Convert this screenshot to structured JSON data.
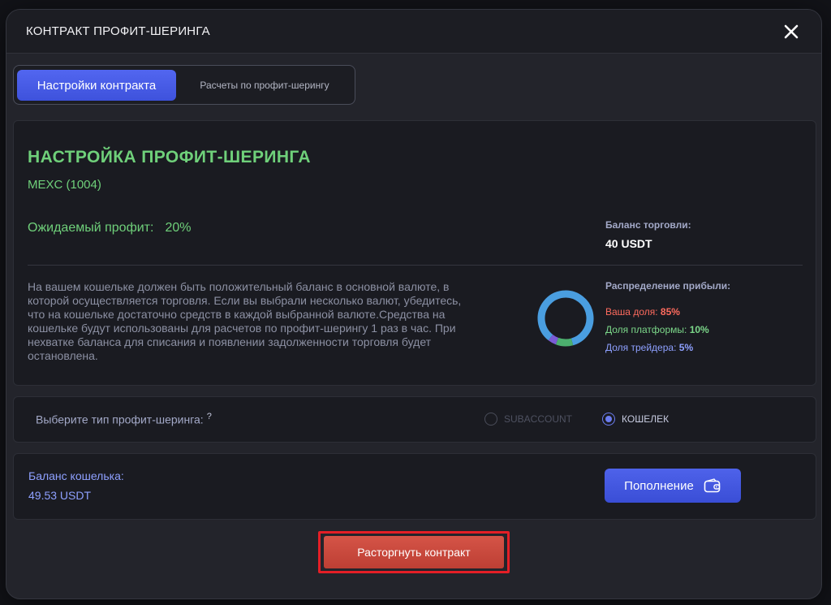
{
  "modal": {
    "title": "КОНТРАКТ ПРОФИТ-ШЕРИНГА"
  },
  "tabs": [
    {
      "label": "Настройки контракта",
      "active": true
    },
    {
      "label": "Расчеты по профит-шерингу",
      "active": false
    }
  ],
  "settings": {
    "title": "НАСТРОЙКА ПРОФИТ-ШЕРИНГА",
    "exchange": "MEXC (1004)",
    "expected_profit_label": "Ожидаемый профит:",
    "expected_profit_value": "20%",
    "trading_balance_label": "Баланс торговли:",
    "trading_balance_value": "40 USDT",
    "info_text": "На вашем кошельке должен быть положительный баланс в основной валюте, в которой осуществляется торговля. Если вы выбрали несколько валют, убедитесь, что на кошельке достаточно средств в каждой выбранной валюте.Средства на кошельке будут использованы для расчетов по профит-шерингу 1 раз в час. При нехватке баланса для списания и появлении задолженности торговля будет остановлена.",
    "distribution_label": "Распределение прибыли:",
    "shares": [
      {
        "label": "Ваша доля:",
        "value": "85%",
        "percent": 85,
        "color": "#4a9ee0"
      },
      {
        "label": "Доля платформы:",
        "value": "10%",
        "percent": 10,
        "color": "#4caf6e"
      },
      {
        "label": "Доля трейдера:",
        "value": "5%",
        "percent": 5,
        "color": "#7a5cd6"
      }
    ]
  },
  "profit_type": {
    "label": "Выберите тип профит-шеринга:",
    "help_glyph": "?",
    "options": [
      {
        "label": "SUBACCOUNT",
        "selected": false
      },
      {
        "label": "КОШЕЛЕК",
        "selected": true
      }
    ]
  },
  "wallet": {
    "balance_label": "Баланс кошелька:",
    "balance_value": "49.53 USDT",
    "topup_label": "Пополнение"
  },
  "actions": {
    "terminate_label": "Расторгнуть контракт"
  },
  "colors": {
    "accent": "#4a5ee8",
    "success": "#6fd07a",
    "danger": "#c9473b"
  }
}
